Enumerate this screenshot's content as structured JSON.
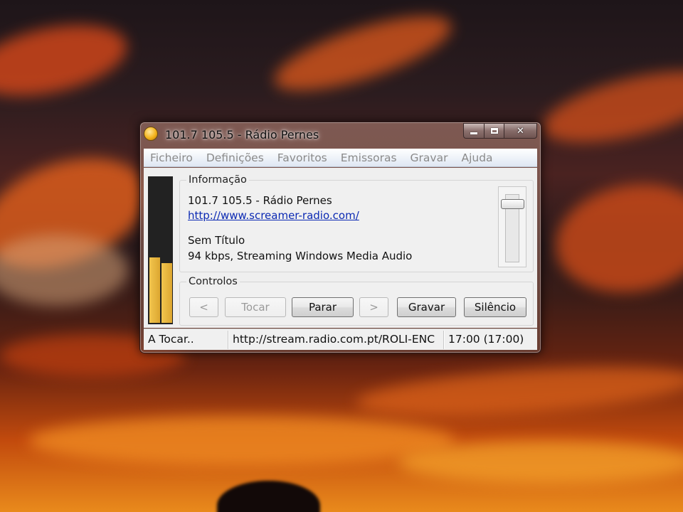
{
  "window": {
    "title": "101.7 105.5 - Rádio Pernes"
  },
  "menu": {
    "items": [
      "Ficheiro",
      "Definições",
      "Favoritos",
      "Emissoras",
      "Gravar",
      "Ajuda"
    ]
  },
  "info": {
    "legend": "Informação",
    "station": "101.7 105.5 - Rádio Pernes",
    "url": "http://www.screamer-radio.com/",
    "track": "Sem Título",
    "stream_info": "94 kbps, Streaming Windows Media Audio"
  },
  "levels": {
    "left": 0.45,
    "right": 0.41
  },
  "volume": {
    "level": 0.92
  },
  "controls": {
    "legend": "Controlos",
    "prev": "<",
    "play": "Tocar",
    "stop": "Parar",
    "next": ">",
    "record": "Gravar",
    "mute": "Silêncio"
  },
  "status": {
    "state": "A Tocar..",
    "stream_url": "http://stream.radio.com.pt/ROLI-ENC",
    "time": "17:00 (17:00)"
  },
  "colors": {
    "meter": "#f2c54e",
    "link": "#0b29b3"
  }
}
